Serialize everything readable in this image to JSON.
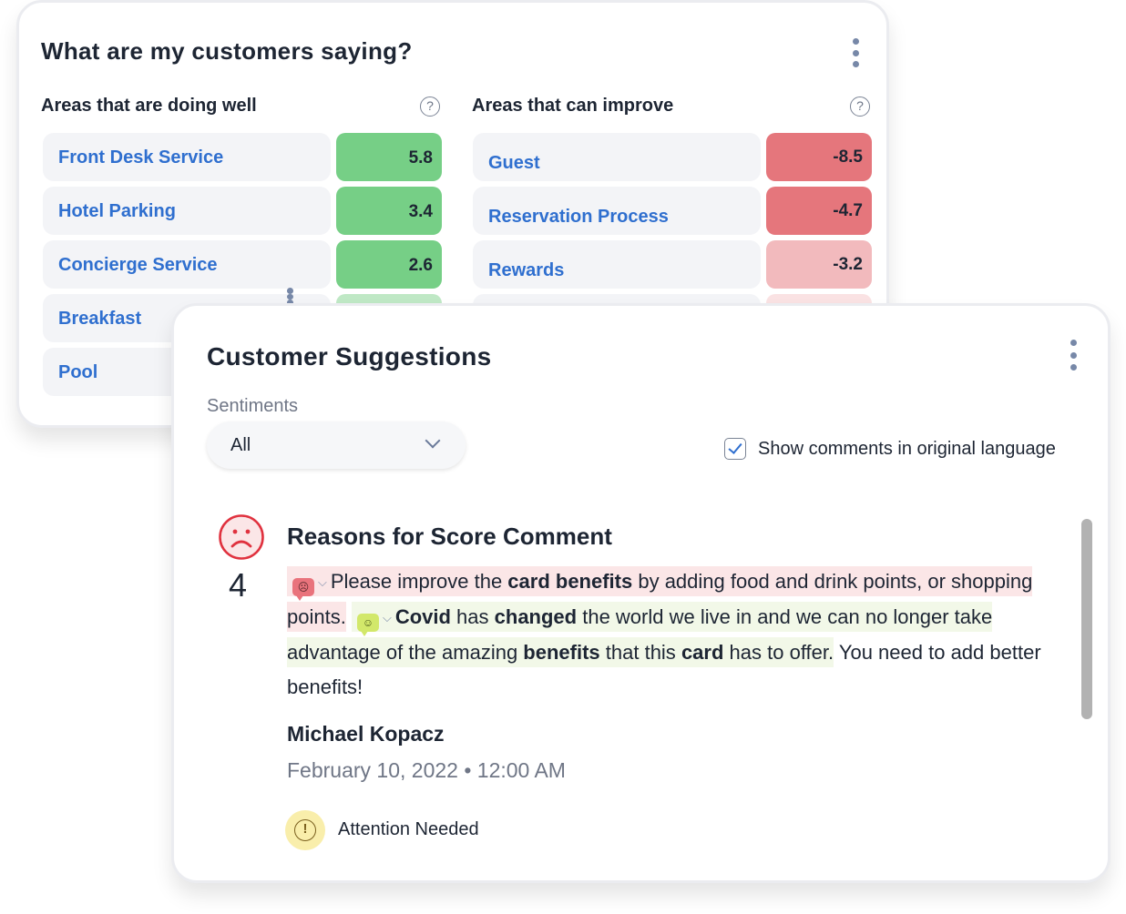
{
  "insights_card": {
    "title": "What are my customers saying?",
    "doing_well": {
      "heading": "Areas that are doing well",
      "items": [
        {
          "label": "Front Desk Service",
          "score": "5.8",
          "color": "#76cf86"
        },
        {
          "label": "Hotel Parking",
          "score": "3.4",
          "color": "#76cf86"
        },
        {
          "label": "Concierge Service",
          "score": "2.6",
          "color": "#76cf86"
        },
        {
          "label": "Breakfast",
          "score": "",
          "color": "#bfe8c5"
        },
        {
          "label": "Pool",
          "score": "",
          "color": "#dff3e2"
        }
      ]
    },
    "can_improve": {
      "heading": "Areas that can improve",
      "items": [
        {
          "label": "Guest",
          "score": "-8.5",
          "color": "#e5767c"
        },
        {
          "label": "Reservation Process",
          "score": "-4.7",
          "color": "#e5767c"
        },
        {
          "label": "Rewards",
          "score": "-3.2",
          "color": "#f2babd"
        },
        {
          "label": "",
          "score": "",
          "color": "#fae2e3"
        }
      ]
    }
  },
  "suggestions_card": {
    "title": "Customer Suggestions",
    "sentiments_label": "Sentiments",
    "sentiments_value": "All",
    "show_original_label": "Show comments in original language",
    "show_original_checked": true,
    "comment": {
      "sentiment_icon": "sad-face-icon",
      "score": "4",
      "title": "Reasons for Score Comment",
      "segments": {
        "neg_1": "Please improve the ",
        "neg_b1": "card benefits",
        "neg_2": " by adding food and drink points, or shopping points.",
        "pos_b1": "Covid",
        "pos_1": " has ",
        "pos_b2": "changed",
        "pos_2": " the world we live in and we can no longer take advantage of the amazing ",
        "pos_b3": "benefits",
        "pos_3": " that this ",
        "pos_b4": "card",
        "pos_4": " has to offer.",
        "plain": " You need to add better benefits!"
      },
      "author": "Michael Kopacz",
      "date": "February 10, 2022 • 12:00 AM",
      "status": "Attention Needed"
    }
  }
}
